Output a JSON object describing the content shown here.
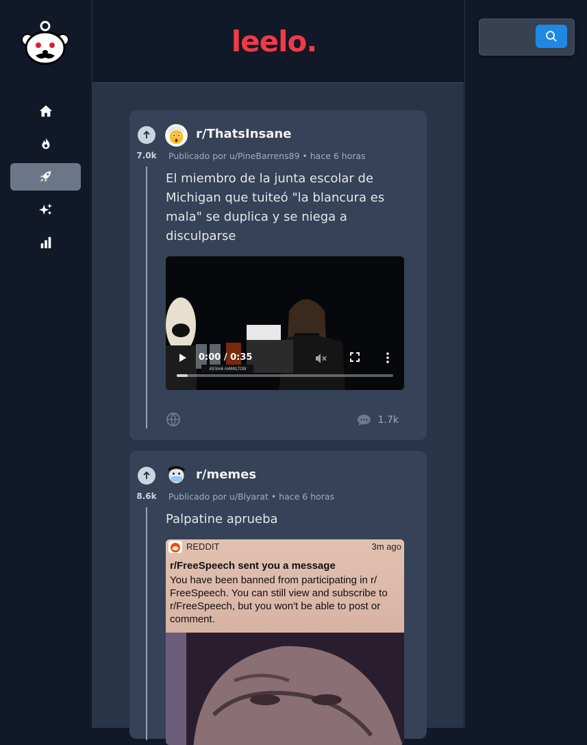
{
  "brand": {
    "name": "leelo."
  },
  "sidebar": {
    "items": [
      {
        "icon": "home-icon",
        "label": "Home",
        "active": false
      },
      {
        "icon": "fire-icon",
        "label": "Hot",
        "active": false
      },
      {
        "icon": "rocket-icon",
        "label": "New",
        "active": true
      },
      {
        "icon": "sparkles-icon",
        "label": "Best",
        "active": false
      },
      {
        "icon": "bar-chart-icon",
        "label": "Top",
        "active": false
      }
    ]
  },
  "search": {
    "placeholder": "",
    "value": ""
  },
  "colors": {
    "accent": "#ef3b47",
    "search_button": "#1e88e5",
    "active_nav": "#6b7689"
  },
  "posts": [
    {
      "subreddit": "r/ThatsInsane",
      "votes": "7.0k",
      "byline": "Publicado por u/PineBarrens89 • hace 6 horas",
      "title": "El miembro de la junta escolar de Michigan que tuiteó \"la blancura es mala\" se duplica y se niega a disculparse",
      "media_type": "video",
      "video_time": "0:00 / 0:35",
      "video_progress": 0.05,
      "video_caption": "KESHA HAMILTON",
      "comments": "1.7k"
    },
    {
      "subreddit": "r/memes",
      "votes": "8.6k",
      "byline": "Publicado por u/Blyarat • hace 6 horas",
      "title": "Palpatine aprueba",
      "media_type": "image",
      "notification": {
        "app": "REDDIT",
        "time": "3m ago",
        "title": "r/FreeSpeech sent you a message",
        "body": "You have been banned from participating in r/ FreeSpeech. You can still view and subscribe to r/FreeSpeech, but you won't be able to post or comment."
      }
    }
  ]
}
